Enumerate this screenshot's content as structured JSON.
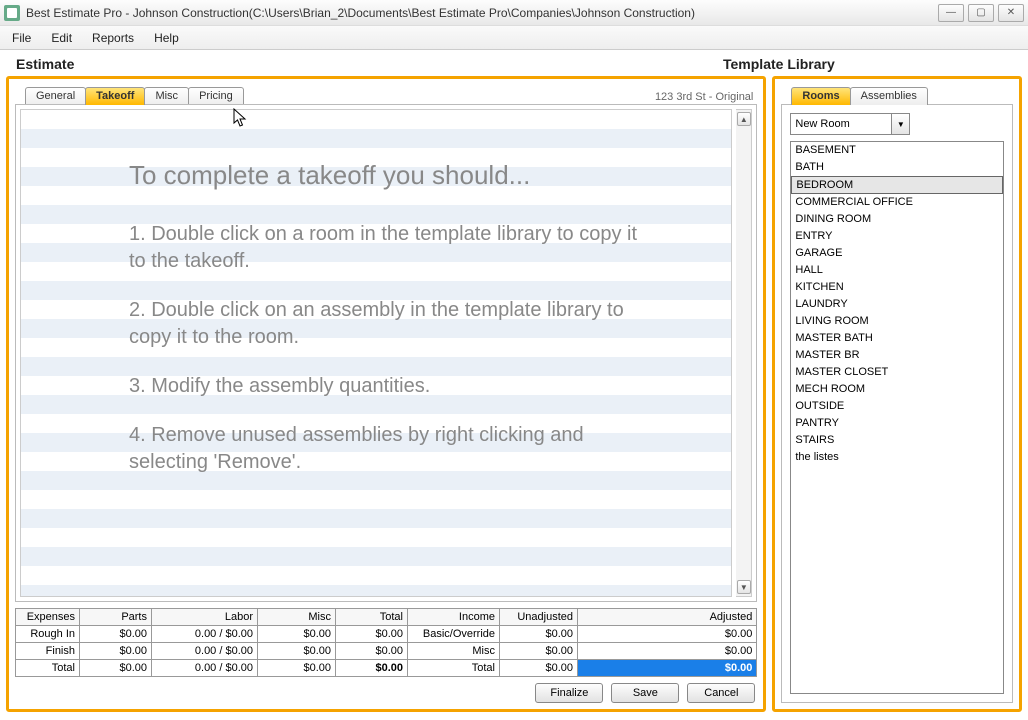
{
  "window": {
    "title": "Best Estimate Pro - Johnson Construction(C:\\Users\\Brian_2\\Documents\\Best Estimate Pro\\Companies\\Johnson Construction)"
  },
  "menu": {
    "file": "File",
    "edit": "Edit",
    "reports": "Reports",
    "help": "Help"
  },
  "left": {
    "title": "Estimate",
    "tabs": {
      "general": "General",
      "takeoff": "Takeoff",
      "misc": "Misc",
      "pricing": "Pricing"
    },
    "breadcrumb": "123 3rd St - Original",
    "instructions": {
      "heading": "To complete a takeoff you should...",
      "step1": "1. Double click on a room in the template library to copy it to the takeoff.",
      "step2": "2. Double click on an assembly in the template library to copy it to the room.",
      "step3": "3. Modify the assembly quantities.",
      "step4": "4. Remove unused assemblies by right clicking and selecting 'Remove'."
    },
    "summary": {
      "headers": {
        "expenses": "Expenses",
        "parts": "Parts",
        "labor": "Labor",
        "misc": "Misc",
        "total": "Total",
        "income": "Income",
        "unadjusted": "Unadjusted",
        "adjusted": "Adjusted"
      },
      "rows": {
        "roughin": {
          "label": "Rough In",
          "parts": "$0.00",
          "labor": "0.00 / $0.00",
          "misc": "$0.00",
          "total": "$0.00",
          "incomelabel": "Basic/Override",
          "unadjusted": "$0.00",
          "adjusted": "$0.00"
        },
        "finish": {
          "label": "Finish",
          "parts": "$0.00",
          "labor": "0.00 / $0.00",
          "misc": "$0.00",
          "total": "$0.00",
          "incomelabel": "Misc",
          "unadjusted": "$0.00",
          "adjusted": "$0.00"
        },
        "total": {
          "label": "Total",
          "parts": "$0.00",
          "labor": "0.00 / $0.00",
          "misc": "$0.00",
          "total": "$0.00",
          "incomelabel": "Total",
          "unadjusted": "$0.00",
          "adjusted": "$0.00"
        }
      }
    },
    "buttons": {
      "finalize": "Finalize",
      "save": "Save",
      "cancel": "Cancel"
    }
  },
  "right": {
    "title": "Template Library",
    "tabs": {
      "rooms": "Rooms",
      "assemblies": "Assemblies"
    },
    "newroom": "New Room",
    "rooms": [
      "BASEMENT",
      "BATH",
      "BEDROOM",
      "COMMERCIAL OFFICE",
      "DINING ROOM",
      "ENTRY",
      "GARAGE",
      "HALL",
      "KITCHEN",
      "LAUNDRY",
      "LIVING ROOM",
      "MASTER BATH",
      "MASTER BR",
      "MASTER CLOSET",
      "MECH ROOM",
      "OUTSIDE",
      "PANTRY",
      "STAIRS",
      "the listes"
    ],
    "selected_index": 2
  }
}
